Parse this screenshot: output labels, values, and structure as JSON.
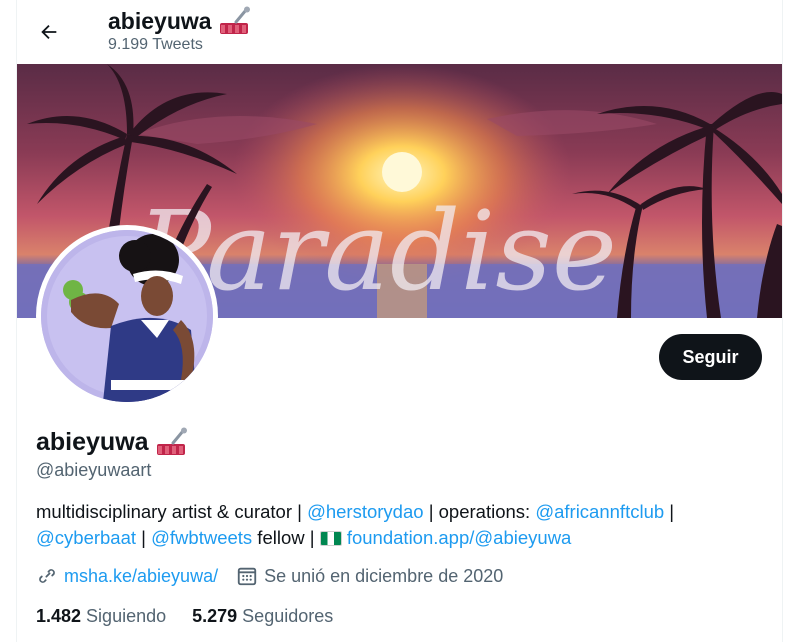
{
  "header": {
    "name": "abieyuwa",
    "tweet_count": "9.199 Tweets"
  },
  "banner": {
    "script_text": "Paradise"
  },
  "profile": {
    "name": "abieyuwa",
    "handle": "@abieyuwaart",
    "follow_label": "Seguir"
  },
  "bio": {
    "t1": "multidisciplinary artist & curator | ",
    "mention1": "@herstorydao",
    "t2": " | operations: ",
    "mention2": "@africannftclub",
    "t3": " | ",
    "mention3": "@cyberbaat",
    "t4": " | ",
    "mention4": "@fwbtweets",
    "t5": " fellow | ",
    "link": "foundation.app/@abieyuwa"
  },
  "meta": {
    "website": "msha.ke/abieyuwa/",
    "joined": "Se unió en diciembre de 2020"
  },
  "stats": {
    "following_count": "1.482",
    "following_label": "Siguiendo",
    "followers_count": "5.279",
    "followers_label": "Seguidores"
  },
  "icons": {
    "back": "arrow-left-icon",
    "emoji": "nail-polish-emoji",
    "flag": "nigeria-flag",
    "link": "link-icon",
    "calendar": "calendar-icon"
  },
  "colors": {
    "accent": "#1d9bf0",
    "text": "#0f1419",
    "secondary": "#536471",
    "button": "#0f1419"
  }
}
